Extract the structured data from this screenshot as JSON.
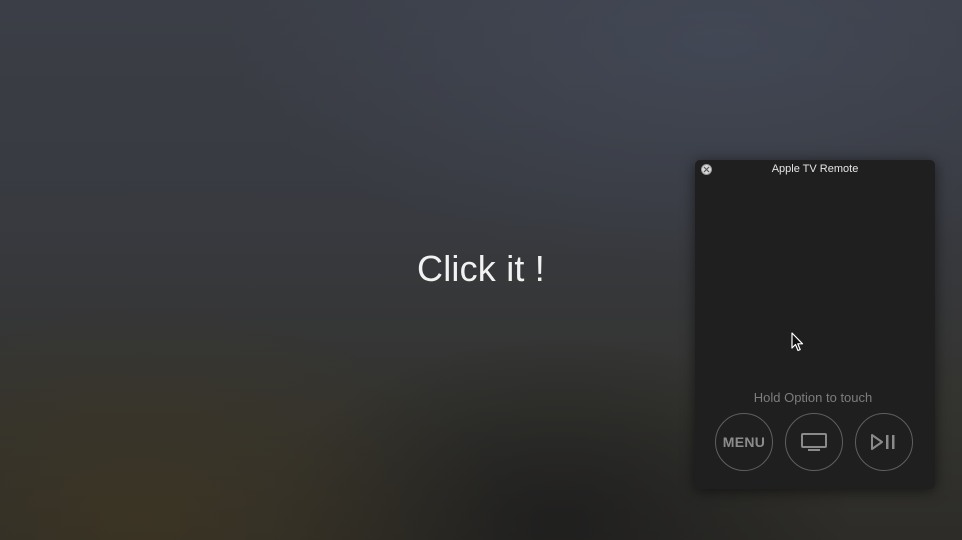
{
  "main": {
    "headline": "Click it !"
  },
  "remote_window": {
    "title": "Apple TV Remote",
    "hint": "Hold Option to touch",
    "buttons": {
      "menu_label": "MENU",
      "tv_icon": "tv-icon",
      "play_pause_icon": "play-pause-icon"
    },
    "close_icon": "close-icon"
  },
  "colors": {
    "panel_background": "#1f1f1f",
    "headline_text": "#f2f2f2",
    "hint_text": "#7d7d7d",
    "button_outline": "#5f5f5f"
  }
}
